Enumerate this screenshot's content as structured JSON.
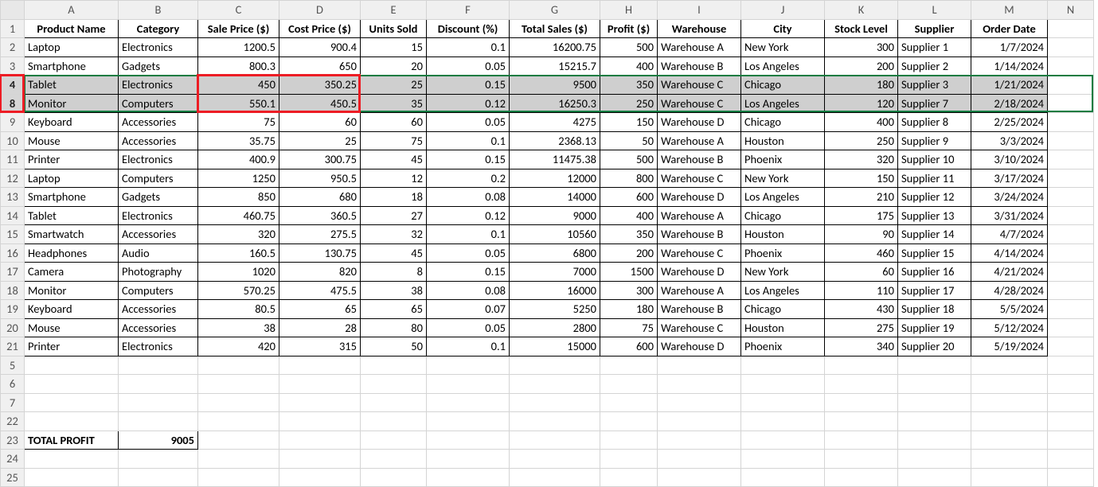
{
  "cols": [
    "A",
    "B",
    "C",
    "D",
    "E",
    "F",
    "G",
    "H",
    "I",
    "J",
    "K",
    "L",
    "M",
    "N"
  ],
  "headers": {
    "A": "Product Name",
    "B": "Category",
    "C": "Sale Price ($)",
    "D": "Cost Price ($)",
    "E": "Units Sold",
    "F": "Discount (%)",
    "G": "Total Sales ($)",
    "H": "Profit ($)",
    "I": "Warehouse",
    "J": "City",
    "K": "Stock Level",
    "L": "Supplier",
    "M": "Order Date"
  },
  "rows": [
    {
      "n": 2,
      "A": "Laptop",
      "B": "Electronics",
      "C": "1200.5",
      "D": "900.4",
      "E": "15",
      "F": "0.1",
      "G": "16200.75",
      "H": "500",
      "I": "Warehouse A",
      "J": "New York",
      "K": "300",
      "L": "Supplier 1",
      "M": "1/7/2024"
    },
    {
      "n": 3,
      "A": "Smartphone",
      "B": "Gadgets",
      "C": "800.3",
      "D": "650",
      "E": "20",
      "F": "0.05",
      "G": "15215.7",
      "H": "400",
      "I": "Warehouse B",
      "J": "Los Angeles",
      "K": "200",
      "L": "Supplier 2",
      "M": "1/14/2024"
    },
    {
      "n": 4,
      "sel": true,
      "A": "Tablet",
      "B": "Electronics",
      "C": "450",
      "D": "350.25",
      "E": "25",
      "F": "0.15",
      "G": "9500",
      "H": "350",
      "I": "Warehouse C",
      "J": "Chicago",
      "K": "180",
      "L": "Supplier 3",
      "M": "1/21/2024"
    },
    {
      "n": 8,
      "sel": true,
      "A": "Monitor",
      "B": "Computers",
      "C": "550.1",
      "D": "450.5",
      "E": "35",
      "F": "0.12",
      "G": "16250.3",
      "H": "250",
      "I": "Warehouse C",
      "J": "Los Angeles",
      "K": "120",
      "L": "Supplier 7",
      "M": "2/18/2024"
    },
    {
      "n": 9,
      "A": "Keyboard",
      "B": "Accessories",
      "C": "75",
      "D": "60",
      "E": "60",
      "F": "0.05",
      "G": "4275",
      "H": "150",
      "I": "Warehouse D",
      "J": "Chicago",
      "K": "400",
      "L": "Supplier 8",
      "M": "2/25/2024"
    },
    {
      "n": 10,
      "A": "Mouse",
      "B": "Accessories",
      "C": "35.75",
      "D": "25",
      "E": "75",
      "F": "0.1",
      "G": "2368.13",
      "H": "50",
      "I": "Warehouse A",
      "J": "Houston",
      "K": "250",
      "L": "Supplier 9",
      "M": "3/3/2024"
    },
    {
      "n": 11,
      "A": "Printer",
      "B": "Electronics",
      "C": "400.9",
      "D": "300.75",
      "E": "45",
      "F": "0.15",
      "G": "11475.38",
      "H": "500",
      "I": "Warehouse B",
      "J": "Phoenix",
      "K": "320",
      "L": "Supplier 10",
      "M": "3/10/2024"
    },
    {
      "n": 12,
      "A": "Laptop",
      "B": "Computers",
      "C": "1250",
      "D": "950.5",
      "E": "12",
      "F": "0.2",
      "G": "12000",
      "H": "800",
      "I": "Warehouse C",
      "J": "New York",
      "K": "150",
      "L": "Supplier 11",
      "M": "3/17/2024"
    },
    {
      "n": 13,
      "A": "Smartphone",
      "B": "Gadgets",
      "C": "850",
      "D": "680",
      "E": "18",
      "F": "0.08",
      "G": "14000",
      "H": "600",
      "I": "Warehouse D",
      "J": "Los Angeles",
      "K": "210",
      "L": "Supplier 12",
      "M": "3/24/2024"
    },
    {
      "n": 14,
      "A": "Tablet",
      "B": "Electronics",
      "C": "460.75",
      "D": "360.5",
      "E": "27",
      "F": "0.12",
      "G": "9000",
      "H": "400",
      "I": "Warehouse A",
      "J": "Chicago",
      "K": "175",
      "L": "Supplier 13",
      "M": "3/31/2024"
    },
    {
      "n": 15,
      "A": "Smartwatch",
      "B": "Accessories",
      "C": "320",
      "D": "275.5",
      "E": "32",
      "F": "0.1",
      "G": "10560",
      "H": "350",
      "I": "Warehouse B",
      "J": "Houston",
      "K": "90",
      "L": "Supplier 14",
      "M": "4/7/2024"
    },
    {
      "n": 16,
      "A": "Headphones",
      "B": "Audio",
      "C": "160.5",
      "D": "130.75",
      "E": "45",
      "F": "0.05",
      "G": "6800",
      "H": "200",
      "I": "Warehouse C",
      "J": "Phoenix",
      "K": "460",
      "L": "Supplier 15",
      "M": "4/14/2024"
    },
    {
      "n": 17,
      "A": "Camera",
      "B": "Photography",
      "C": "1020",
      "D": "820",
      "E": "8",
      "F": "0.15",
      "G": "7000",
      "H": "1500",
      "I": "Warehouse D",
      "J": "New York",
      "K": "60",
      "L": "Supplier 16",
      "M": "4/21/2024"
    },
    {
      "n": 18,
      "A": "Monitor",
      "B": "Computers",
      "C": "570.25",
      "D": "475.5",
      "E": "38",
      "F": "0.08",
      "G": "16000",
      "H": "300",
      "I": "Warehouse A",
      "J": "Los Angeles",
      "K": "110",
      "L": "Supplier 17",
      "M": "4/28/2024"
    },
    {
      "n": 19,
      "A": "Keyboard",
      "B": "Accessories",
      "C": "80.5",
      "D": "65",
      "E": "65",
      "F": "0.07",
      "G": "5250",
      "H": "180",
      "I": "Warehouse B",
      "J": "Chicago",
      "K": "430",
      "L": "Supplier 18",
      "M": "5/5/2024"
    },
    {
      "n": 20,
      "A": "Mouse",
      "B": "Accessories",
      "C": "38",
      "D": "28",
      "E": "80",
      "F": "0.05",
      "G": "2800",
      "H": "75",
      "I": "Warehouse C",
      "J": "Houston",
      "K": "275",
      "L": "Supplier 19",
      "M": "5/12/2024"
    },
    {
      "n": 21,
      "A": "Printer",
      "B": "Electronics",
      "C": "420",
      "D": "315",
      "E": "50",
      "F": "0.1",
      "G": "15000",
      "H": "600",
      "I": "Warehouse D",
      "J": "Phoenix",
      "K": "340",
      "L": "Supplier 20",
      "M": "5/19/2024"
    }
  ],
  "total": {
    "row": 23,
    "label": "TOTAL PROFIT",
    "value": "9005"
  },
  "emptyRows": [
    22,
    24,
    25
  ],
  "numericCols": [
    "C",
    "D",
    "E",
    "F",
    "G",
    "H",
    "K",
    "M"
  ]
}
